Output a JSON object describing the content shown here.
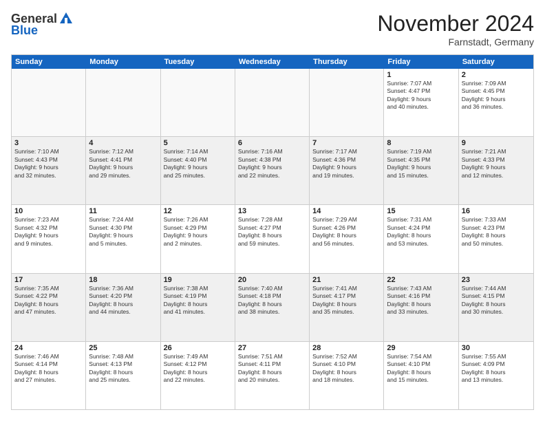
{
  "header": {
    "logo": {
      "general": "General",
      "blue": "Blue"
    },
    "title": "November 2024",
    "location": "Farnstadt, Germany"
  },
  "weekdays": [
    "Sunday",
    "Monday",
    "Tuesday",
    "Wednesday",
    "Thursday",
    "Friday",
    "Saturday"
  ],
  "weeks": [
    [
      {
        "day": "",
        "info": ""
      },
      {
        "day": "",
        "info": ""
      },
      {
        "day": "",
        "info": ""
      },
      {
        "day": "",
        "info": ""
      },
      {
        "day": "",
        "info": ""
      },
      {
        "day": "1",
        "info": "Sunrise: 7:07 AM\nSunset: 4:47 PM\nDaylight: 9 hours\nand 40 minutes."
      },
      {
        "day": "2",
        "info": "Sunrise: 7:09 AM\nSunset: 4:45 PM\nDaylight: 9 hours\nand 36 minutes."
      }
    ],
    [
      {
        "day": "3",
        "info": "Sunrise: 7:10 AM\nSunset: 4:43 PM\nDaylight: 9 hours\nand 32 minutes."
      },
      {
        "day": "4",
        "info": "Sunrise: 7:12 AM\nSunset: 4:41 PM\nDaylight: 9 hours\nand 29 minutes."
      },
      {
        "day": "5",
        "info": "Sunrise: 7:14 AM\nSunset: 4:40 PM\nDaylight: 9 hours\nand 25 minutes."
      },
      {
        "day": "6",
        "info": "Sunrise: 7:16 AM\nSunset: 4:38 PM\nDaylight: 9 hours\nand 22 minutes."
      },
      {
        "day": "7",
        "info": "Sunrise: 7:17 AM\nSunset: 4:36 PM\nDaylight: 9 hours\nand 19 minutes."
      },
      {
        "day": "8",
        "info": "Sunrise: 7:19 AM\nSunset: 4:35 PM\nDaylight: 9 hours\nand 15 minutes."
      },
      {
        "day": "9",
        "info": "Sunrise: 7:21 AM\nSunset: 4:33 PM\nDaylight: 9 hours\nand 12 minutes."
      }
    ],
    [
      {
        "day": "10",
        "info": "Sunrise: 7:23 AM\nSunset: 4:32 PM\nDaylight: 9 hours\nand 9 minutes."
      },
      {
        "day": "11",
        "info": "Sunrise: 7:24 AM\nSunset: 4:30 PM\nDaylight: 9 hours\nand 5 minutes."
      },
      {
        "day": "12",
        "info": "Sunrise: 7:26 AM\nSunset: 4:29 PM\nDaylight: 9 hours\nand 2 minutes."
      },
      {
        "day": "13",
        "info": "Sunrise: 7:28 AM\nSunset: 4:27 PM\nDaylight: 8 hours\nand 59 minutes."
      },
      {
        "day": "14",
        "info": "Sunrise: 7:29 AM\nSunset: 4:26 PM\nDaylight: 8 hours\nand 56 minutes."
      },
      {
        "day": "15",
        "info": "Sunrise: 7:31 AM\nSunset: 4:24 PM\nDaylight: 8 hours\nand 53 minutes."
      },
      {
        "day": "16",
        "info": "Sunrise: 7:33 AM\nSunset: 4:23 PM\nDaylight: 8 hours\nand 50 minutes."
      }
    ],
    [
      {
        "day": "17",
        "info": "Sunrise: 7:35 AM\nSunset: 4:22 PM\nDaylight: 8 hours\nand 47 minutes."
      },
      {
        "day": "18",
        "info": "Sunrise: 7:36 AM\nSunset: 4:20 PM\nDaylight: 8 hours\nand 44 minutes."
      },
      {
        "day": "19",
        "info": "Sunrise: 7:38 AM\nSunset: 4:19 PM\nDaylight: 8 hours\nand 41 minutes."
      },
      {
        "day": "20",
        "info": "Sunrise: 7:40 AM\nSunset: 4:18 PM\nDaylight: 8 hours\nand 38 minutes."
      },
      {
        "day": "21",
        "info": "Sunrise: 7:41 AM\nSunset: 4:17 PM\nDaylight: 8 hours\nand 35 minutes."
      },
      {
        "day": "22",
        "info": "Sunrise: 7:43 AM\nSunset: 4:16 PM\nDaylight: 8 hours\nand 33 minutes."
      },
      {
        "day": "23",
        "info": "Sunrise: 7:44 AM\nSunset: 4:15 PM\nDaylight: 8 hours\nand 30 minutes."
      }
    ],
    [
      {
        "day": "24",
        "info": "Sunrise: 7:46 AM\nSunset: 4:14 PM\nDaylight: 8 hours\nand 27 minutes."
      },
      {
        "day": "25",
        "info": "Sunrise: 7:48 AM\nSunset: 4:13 PM\nDaylight: 8 hours\nand 25 minutes."
      },
      {
        "day": "26",
        "info": "Sunrise: 7:49 AM\nSunset: 4:12 PM\nDaylight: 8 hours\nand 22 minutes."
      },
      {
        "day": "27",
        "info": "Sunrise: 7:51 AM\nSunset: 4:11 PM\nDaylight: 8 hours\nand 20 minutes."
      },
      {
        "day": "28",
        "info": "Sunrise: 7:52 AM\nSunset: 4:10 PM\nDaylight: 8 hours\nand 18 minutes."
      },
      {
        "day": "29",
        "info": "Sunrise: 7:54 AM\nSunset: 4:10 PM\nDaylight: 8 hours\nand 15 minutes."
      },
      {
        "day": "30",
        "info": "Sunrise: 7:55 AM\nSunset: 4:09 PM\nDaylight: 8 hours\nand 13 minutes."
      }
    ]
  ]
}
